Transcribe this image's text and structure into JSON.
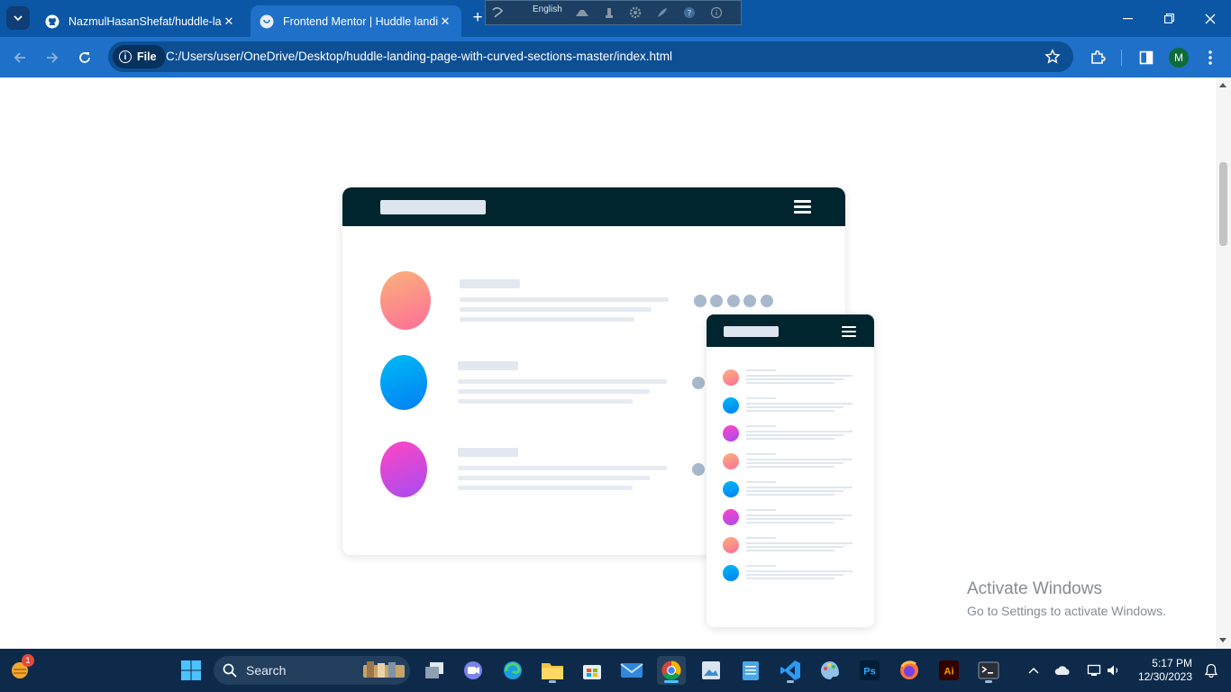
{
  "browser": {
    "tabs": [
      {
        "title": "NazmulHasanShefat/huddle-landing",
        "active": false
      },
      {
        "title": "Frontend Mentor | Huddle landing",
        "active": true
      }
    ],
    "new_tab_label": "+",
    "ime_bar": {
      "language": "English"
    },
    "address": {
      "scheme_label": "File",
      "url": "C:/Users/user/OneDrive/Desktop/huddle-landing-page-with-curved-sections-master/index.html"
    },
    "profile_initial": "M",
    "accent": "#1f70c8"
  },
  "page": {
    "colors": {
      "navy": "#00252e",
      "peach": "#fb8e85",
      "blue": "#00a8f5",
      "pink": "#e846d6"
    }
  },
  "watermark": {
    "title": "Activate Windows",
    "subtitle": "Go to Settings to activate Windows."
  },
  "taskbar": {
    "search_placeholder": "Search",
    "widget_badge": "1",
    "time": "5:17 PM",
    "date": "12/30/2023",
    "pinned": [
      "task-view",
      "meet",
      "edge",
      "file-explorer",
      "microsoft-store",
      "mail",
      "chrome",
      "photos",
      "notepad",
      "vscode",
      "paint",
      "photoshop",
      "firefox",
      "illustrator",
      "terminal"
    ]
  }
}
